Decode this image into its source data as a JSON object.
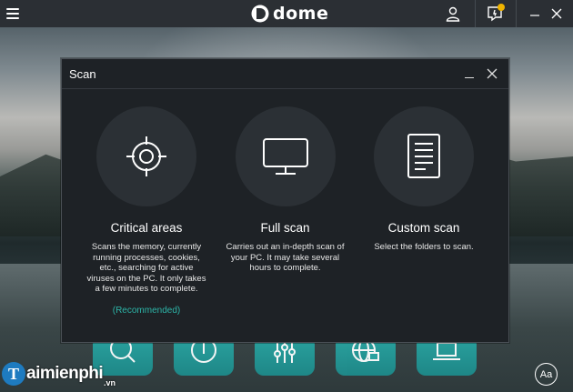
{
  "app": {
    "logo_text": "dome"
  },
  "modal": {
    "title": "Scan",
    "options": [
      {
        "title": "Critical areas",
        "description": "Scans the memory, currently running processes, cookies, etc., searching for active viruses on the PC. It only takes a few minutes to complete.",
        "recommended": "(Recommended)",
        "icon": "crosshair-icon"
      },
      {
        "title": "Full scan",
        "description": "Carries out an in-depth scan of your PC. It may take several hours to complete.",
        "icon": "monitor-icon"
      },
      {
        "title": "Custom scan",
        "description": "Select the folders to scan.",
        "icon": "document-icon"
      }
    ]
  },
  "dock": {
    "items": [
      "search-icon",
      "power-icon",
      "sliders-icon",
      "globe-lock-icon",
      "laptop-icon"
    ]
  },
  "font_button": {
    "label": "Aa"
  },
  "watermark": {
    "prefix": "T",
    "text": "aimienphi",
    "suffix": ".vn"
  },
  "colors": {
    "accent": "#2db5a8",
    "dock": "#2aa7a4",
    "notification": "#f0b400",
    "topbar": "#2b2f34",
    "modal_bg": "#1e2226"
  }
}
